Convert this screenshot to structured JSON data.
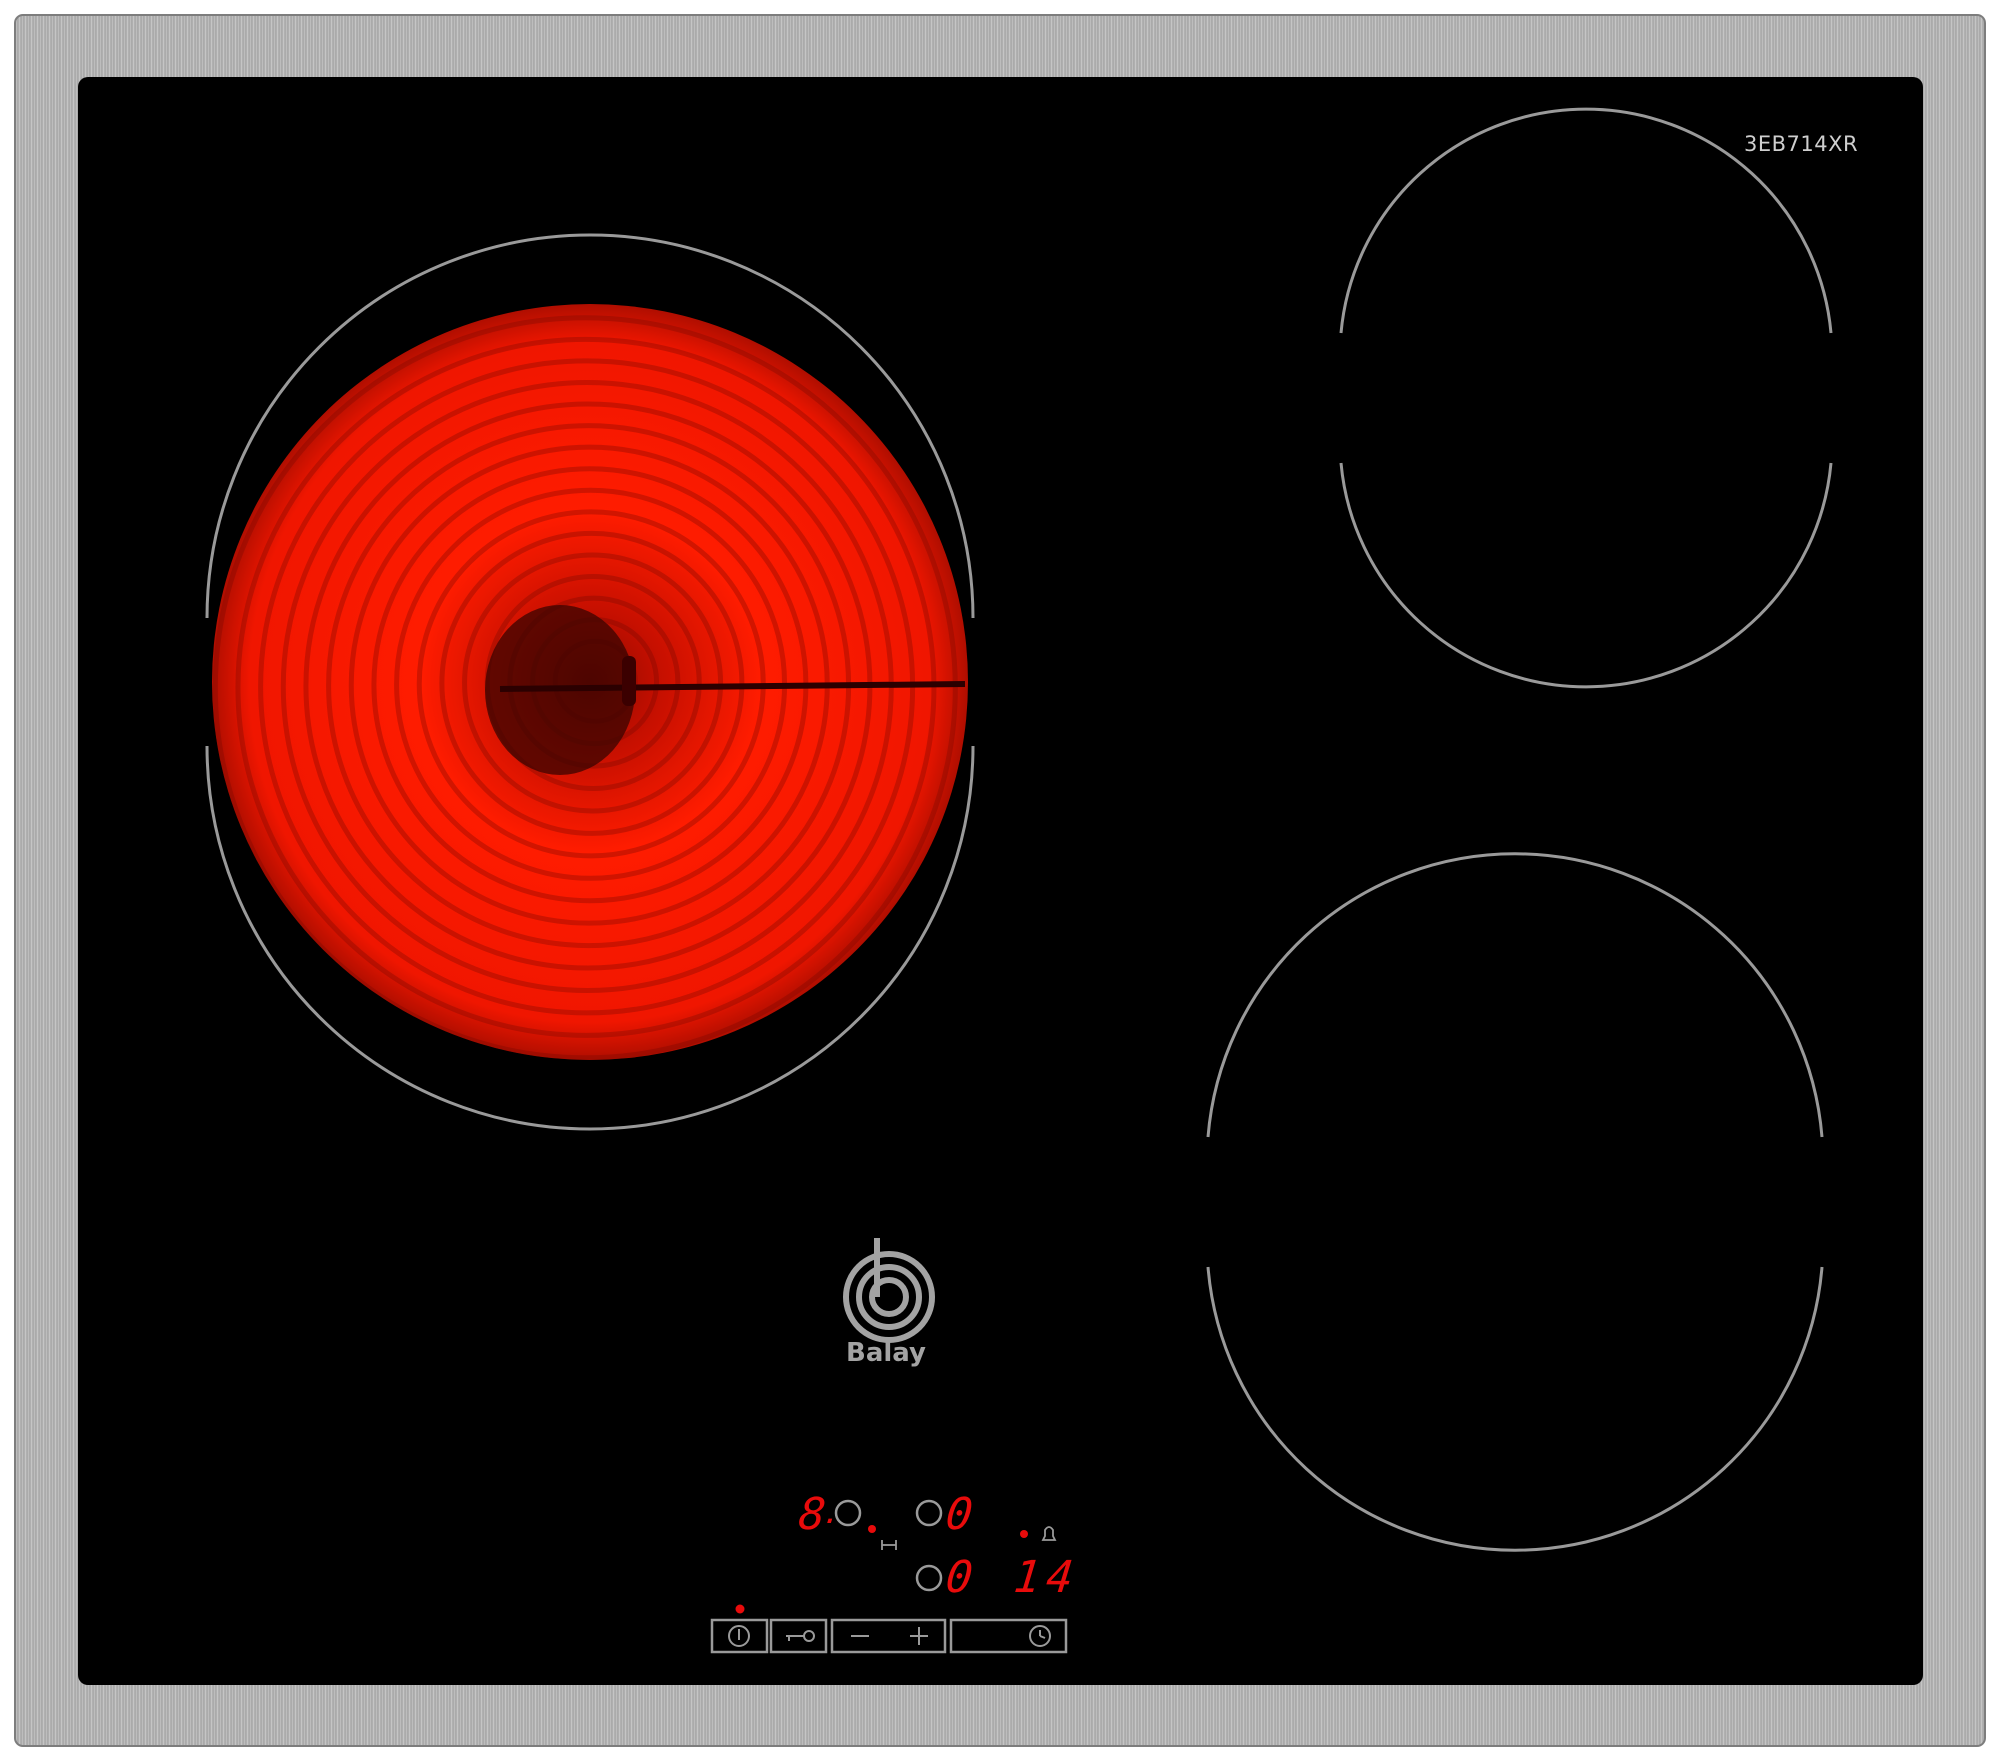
{
  "product": {
    "model": "3EB714XR",
    "brand": "Balay"
  },
  "display": {
    "zone_level": "8",
    "zone_level_dot": ".",
    "timer_main": "0",
    "timer_secondary": "0",
    "timer_minutes": "14"
  },
  "controls": [
    {
      "id": "power",
      "icon": "power-icon"
    },
    {
      "id": "lock",
      "icon": "key-lock-icon"
    },
    {
      "id": "minus",
      "icon": "minus-icon"
    },
    {
      "id": "plus",
      "icon": "plus-icon"
    },
    {
      "id": "timer",
      "icon": "clock-icon"
    }
  ],
  "cooking_zones": [
    {
      "id": "front-left",
      "state": "on",
      "glow_color": "#ff1a00"
    },
    {
      "id": "rear-right",
      "state": "off"
    },
    {
      "id": "front-right",
      "state": "off"
    }
  ],
  "colors": {
    "glass": "#000000",
    "frame": "#a9a9a9",
    "marking": "#9a9a9a",
    "indicator": "#e80b0b"
  }
}
